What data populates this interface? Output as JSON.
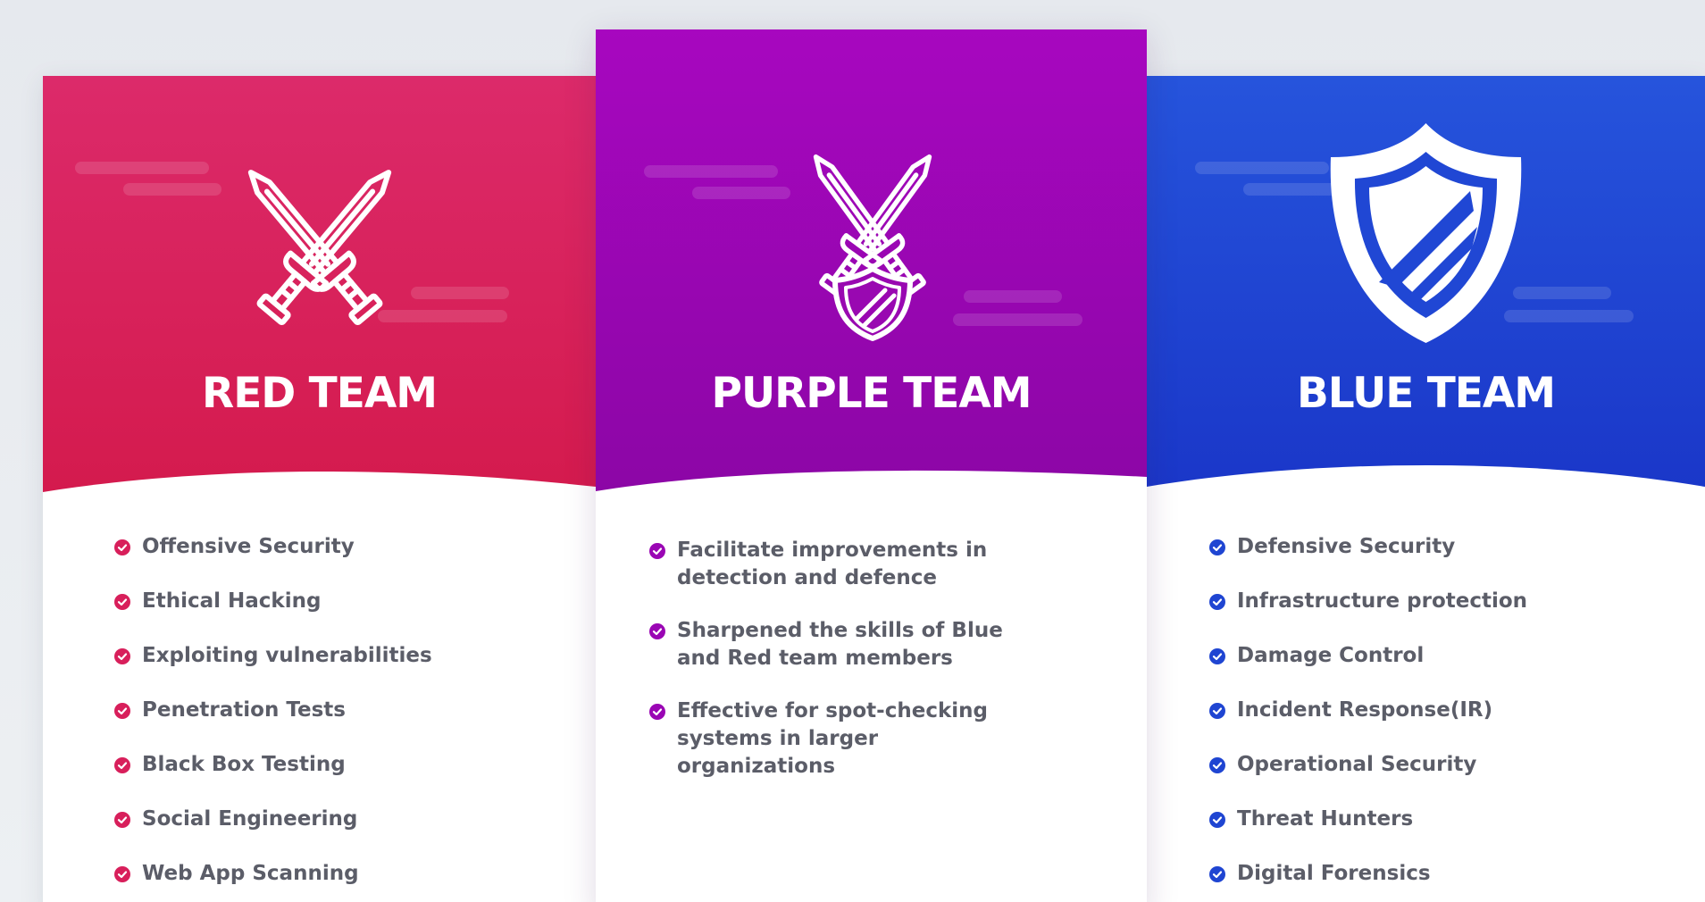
{
  "theme": {
    "red_accent": "#d81f5b",
    "purple_accent": "#9a06b4",
    "blue_accent": "#1f45d2",
    "text_color": "#5b5d68"
  },
  "cards": [
    {
      "title": "RED TEAM",
      "icon": "crossed-swords-icon",
      "features": [
        "Offensive Security",
        "Ethical Hacking",
        "Exploiting vulnerabilities",
        "Penetration Tests",
        "Black Box Testing",
        "Social Engineering",
        "Web App Scanning"
      ]
    },
    {
      "title": "PURPLE TEAM",
      "icon": "swords-and-shield-icon",
      "features": [
        "Facilitate improvements in detection and defence",
        "Sharpened the skills of Blue and Red team members",
        "Effective for spot-checking systems in larger organizations"
      ]
    },
    {
      "title": "BLUE TEAM",
      "icon": "shield-icon",
      "features": [
        "Defensive Security",
        "Infrastructure protection",
        "Damage Control",
        "Incident Response(IR)",
        "Operational Security",
        "Threat Hunters",
        "Digital Forensics"
      ]
    }
  ]
}
